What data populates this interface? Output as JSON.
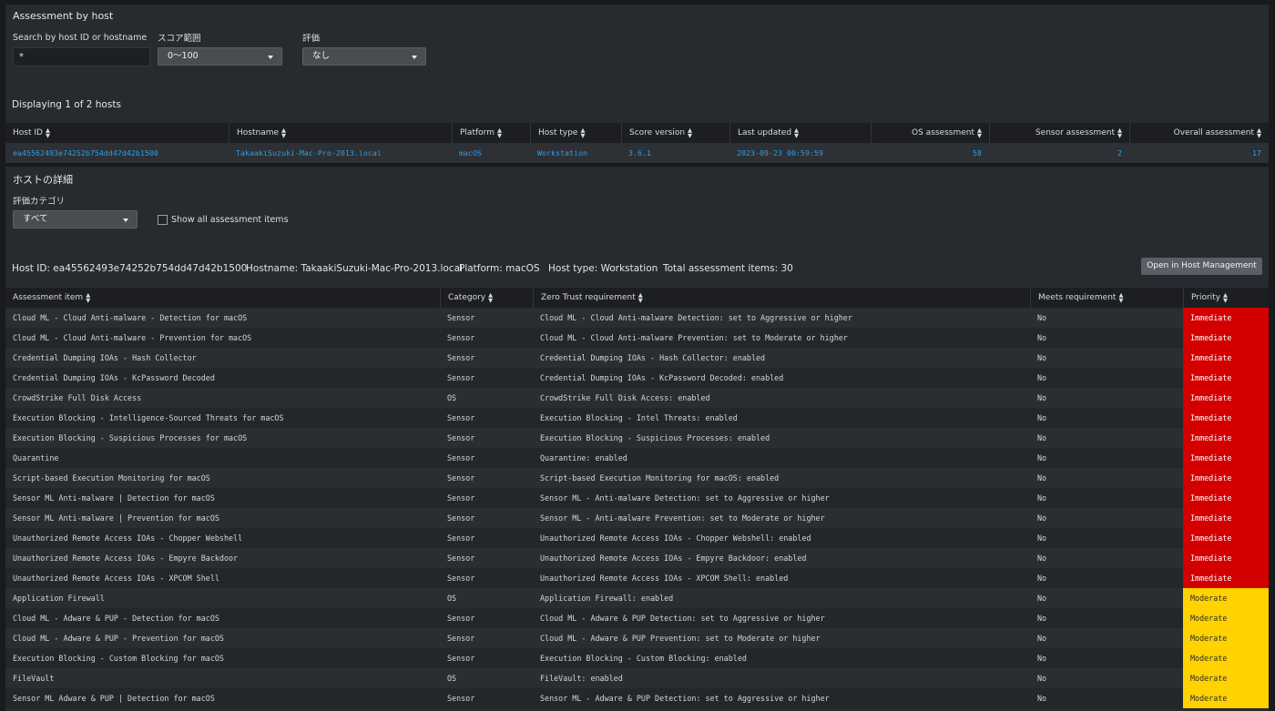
{
  "assessment_by_host": {
    "title": "Assessment by host",
    "search": {
      "label": "Search by host ID or hostname",
      "value": "*"
    },
    "score_range": {
      "label": "スコア範囲",
      "value": "0〜100"
    },
    "rating": {
      "label": "評価",
      "value": "なし"
    },
    "displaying": "Displaying 1 of 2 hosts",
    "columns": [
      "Host ID",
      "Hostname",
      "Platform",
      "Host type",
      "Score version",
      "Last updated",
      "OS assessment",
      "Sensor assessment",
      "Overall assessment"
    ],
    "row": {
      "host_id": "ea45562493e74252b754dd47d42b1500",
      "hostname": "TakaakiSuzuki-Mac-Pro-2013.local",
      "platform": "macOS",
      "host_type": "Workstation",
      "score_version": "3.6.1",
      "last_updated": "2023-09-23 00:59:59",
      "os_assessment": "58",
      "sensor_assessment": "2",
      "overall_assessment": "17"
    }
  },
  "host_details": {
    "title": "ホストの詳細",
    "category": {
      "label": "評価カテゴリ",
      "value": "すべて"
    },
    "show_all_label": "Show all assessment items",
    "info": {
      "host_id": "Host ID: ea45562493e74252b754dd47d42b1500",
      "hostname": "Hostname: TakaakiSuzuki-Mac-Pro-2013.local",
      "platform": "Platform: macOS",
      "host_type": "Host type: Workstation",
      "total": "Total assessment items: 30"
    },
    "open_button": "Open in Host Management",
    "columns": [
      "Assessment item",
      "Category",
      "Zero Trust requirement",
      "Meets requirement",
      "Priority"
    ],
    "items": [
      [
        "Cloud ML - Cloud Anti-malware - Detection for macOS",
        "Sensor",
        "Cloud ML - Cloud Anti-malware Detection: set to Aggressive or higher",
        "No",
        "Immediate"
      ],
      [
        "Cloud ML - Cloud Anti-malware - Prevention for macOS",
        "Sensor",
        "Cloud ML - Cloud Anti-malware Prevention: set to Moderate or higher",
        "No",
        "Immediate"
      ],
      [
        "Credential Dumping IOAs - Hash Collector",
        "Sensor",
        "Credential Dumping IOAs - Hash Collector: enabled",
        "No",
        "Immediate"
      ],
      [
        "Credential Dumping IOAs - KcPassword Decoded",
        "Sensor",
        "Credential Dumping IOAs - KcPassword Decoded: enabled",
        "No",
        "Immediate"
      ],
      [
        "CrowdStrike Full Disk Access",
        "OS",
        "CrowdStrike Full Disk Access: enabled",
        "No",
        "Immediate"
      ],
      [
        "Execution Blocking - Intelligence-Sourced Threats for macOS",
        "Sensor",
        "Execution Blocking - Intel Threats: enabled",
        "No",
        "Immediate"
      ],
      [
        "Execution Blocking - Suspicious Processes for macOS",
        "Sensor",
        "Execution Blocking - Suspicious Processes: enabled",
        "No",
        "Immediate"
      ],
      [
        "Quarantine",
        "Sensor",
        "Quarantine: enabled",
        "No",
        "Immediate"
      ],
      [
        "Script-based Execution Monitoring for macOS",
        "Sensor",
        "Script-based Execution Monitoring for macOS: enabled",
        "No",
        "Immediate"
      ],
      [
        "Sensor ML Anti-malware | Detection for macOS",
        "Sensor",
        "Sensor ML - Anti-malware Detection: set to Aggressive or higher",
        "No",
        "Immediate"
      ],
      [
        "Sensor ML Anti-malware | Prevention for macOS",
        "Sensor",
        "Sensor ML - Anti-malware Prevention: set to Moderate or higher",
        "No",
        "Immediate"
      ],
      [
        "Unauthorized Remote Access IOAs - Chopper Webshell",
        "Sensor",
        "Unauthorized Remote Access IOAs - Chopper Webshell: enabled",
        "No",
        "Immediate"
      ],
      [
        "Unauthorized Remote Access IOAs - Empyre Backdoor",
        "Sensor",
        "Unauthorized Remote Access IOAs - Empyre Backdoor: enabled",
        "No",
        "Immediate"
      ],
      [
        "Unauthorized Remote Access IOAs - XPCOM Shell",
        "Sensor",
        "Unauthorized Remote Access IOAs - XPCOM Shell: enabled",
        "No",
        "Immediate"
      ],
      [
        "Application Firewall",
        "OS",
        "Application Firewall: enabled",
        "No",
        "Moderate"
      ],
      [
        "Cloud ML - Adware & PUP - Detection for macOS",
        "Sensor",
        "Cloud ML - Adware & PUP Detection: set to Aggressive or higher",
        "No",
        "Moderate"
      ],
      [
        "Cloud ML - Adware & PUP - Prevention for macOS",
        "Sensor",
        "Cloud ML - Adware & PUP Prevention: set to Moderate or higher",
        "No",
        "Moderate"
      ],
      [
        "Execution Blocking - Custom Blocking for macOS",
        "Sensor",
        "Execution Blocking - Custom Blocking: enabled",
        "No",
        "Moderate"
      ],
      [
        "FileVault",
        "OS",
        "FileVault: enabled",
        "No",
        "Moderate"
      ],
      [
        "Sensor ML Adware & PUP | Detection for macOS",
        "Sensor",
        "Sensor ML - Adware & PUP Detection: set to Aggressive or higher",
        "No",
        "Moderate"
      ]
    ]
  },
  "colors": {
    "immediate": "#d40000",
    "moderate": "#ffd200",
    "link": "#2f9ee6"
  }
}
